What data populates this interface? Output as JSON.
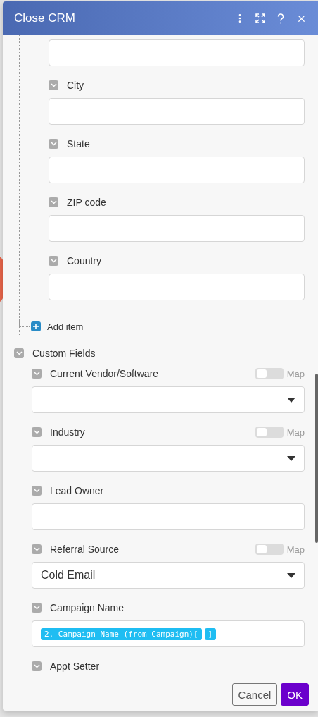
{
  "window": {
    "title": "Close CRM"
  },
  "address_fields": [
    {
      "kind": "field"
    },
    {
      "kind": "labeled",
      "label": "City"
    },
    {
      "kind": "labeled",
      "label": "State"
    },
    {
      "kind": "labeled",
      "label": "ZIP code"
    },
    {
      "kind": "labeled",
      "label": "Country"
    }
  ],
  "add_item": {
    "label": "Add item"
  },
  "custom_fields": {
    "label": "Custom Fields",
    "fields": [
      {
        "label": "Current Vendor/Software",
        "kind": "select",
        "map": {
          "label": "Map",
          "on": false
        }
      },
      {
        "label": "Industry",
        "kind": "select",
        "map": {
          "label": "Map",
          "on": false
        }
      },
      {
        "label": "Lead Owner",
        "kind": "text"
      },
      {
        "label": "Referral Source",
        "kind": "select",
        "value": "Cold Email",
        "map": {
          "label": "Map",
          "on": false
        }
      },
      {
        "label": "Campaign Name",
        "kind": "tokens",
        "tokens": [
          "2. Campaign Name (from Campaign)[",
          "]"
        ]
      },
      {
        "label": "Appt Setter",
        "kind": "label_only"
      }
    ]
  },
  "buttons": [
    {
      "label": "Cancel",
      "kind": "secondary"
    },
    {
      "label": "OK",
      "kind": "primary"
    }
  ]
}
